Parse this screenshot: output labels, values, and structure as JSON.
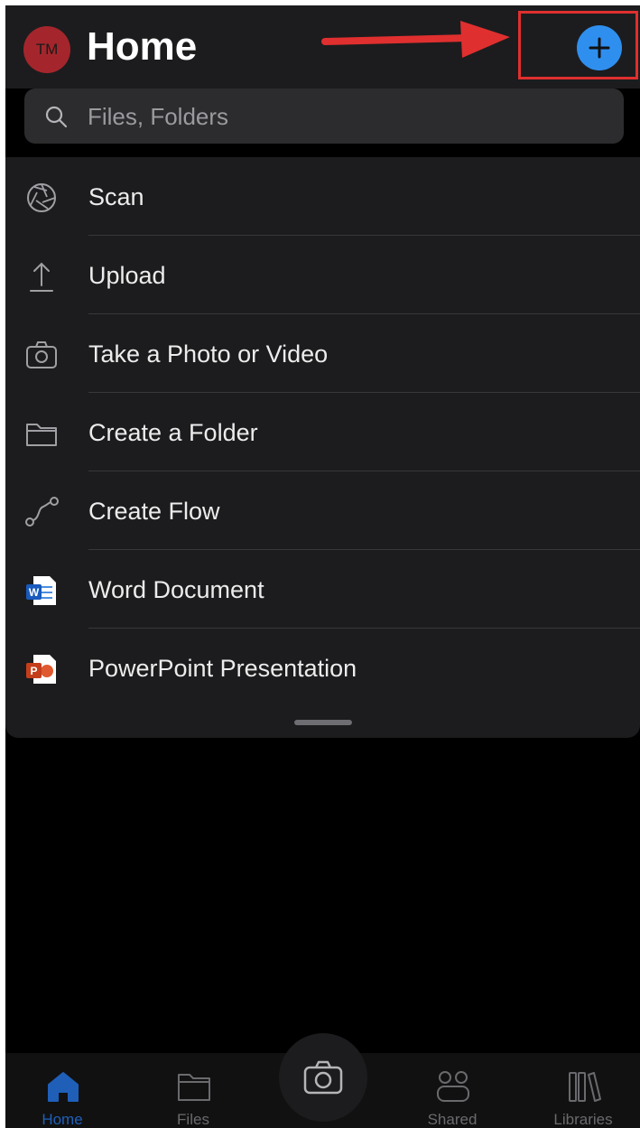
{
  "header": {
    "avatar_initials": "TM",
    "title": "Home",
    "add_button_icon": "plus-icon"
  },
  "search": {
    "placeholder": "Files, Folders",
    "icon": "search-icon"
  },
  "menu": {
    "items": [
      {
        "label": "Scan",
        "icon": "scan-aperture-icon"
      },
      {
        "label": "Upload",
        "icon": "upload-icon"
      },
      {
        "label": "Take a Photo or Video",
        "icon": "camera-icon"
      },
      {
        "label": "Create a Folder",
        "icon": "folder-icon"
      },
      {
        "label": "Create Flow",
        "icon": "flow-icon"
      },
      {
        "label": "Word Document",
        "icon": "word-document-icon"
      },
      {
        "label": "PowerPoint Presentation",
        "icon": "powerpoint-icon"
      }
    ]
  },
  "tabs": [
    {
      "label": "Home",
      "icon": "home-icon",
      "active": true
    },
    {
      "label": "Files",
      "icon": "folder-icon"
    },
    {
      "label": "Shared",
      "icon": "shared-people-icon"
    },
    {
      "label": "Libraries",
      "icon": "libraries-icon"
    }
  ],
  "camera_fab": {
    "icon": "camera-icon"
  },
  "colors": {
    "accent_blue": "#2f8fef",
    "avatar_red": "#a4262c",
    "annotation_red": "#e02f2f",
    "background": "#000000",
    "sheet": "#1c1c1e"
  }
}
